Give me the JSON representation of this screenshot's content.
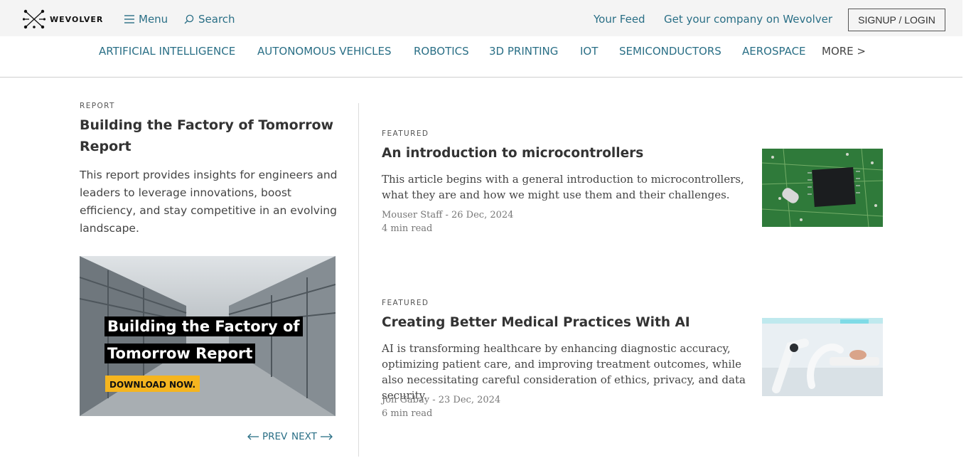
{
  "header": {
    "logo_text": "WEVOLVER",
    "menu_label": "Menu",
    "search_label": "Search",
    "your_feed": "Your Feed",
    "get_company": "Get your company on Wevolver",
    "signup_login": "SIGNUP / LOGIN"
  },
  "categories": [
    "ARTIFICIAL INTELLIGENCE",
    "AUTONOMOUS VEHICLES",
    "ROBOTICS",
    "3D PRINTING",
    "IOT",
    "SEMICONDUCTORS",
    "AEROSPACE",
    "MORE >"
  ],
  "report": {
    "eyebrow": "REPORT",
    "title": "Building the Factory of Tomorrow Report",
    "description": "This report provides insights for engineers and leaders to leverage innovations, boost efficiency, and stay competitive in an evolving landscape.",
    "banner_line1": "Building the Factory of",
    "banner_line2": "Tomorrow Report",
    "banner_cta": "DOWNLOAD NOW.",
    "prev_label": "PREV",
    "next_label": "NEXT"
  },
  "featured": [
    {
      "eyebrow": "FEATURED",
      "title": "An introduction to microcontrollers",
      "description": "This article begins with a general introduction to microcontrollers, what they are and how we might use them and their challenges.",
      "byline": "Mouser Staff - 26 Dec, 2024",
      "read_time": "4 min read",
      "image_icon": "microcontroller-chip-photo"
    },
    {
      "eyebrow": "FEATURED",
      "title": "Creating Better Medical Practices With AI",
      "description": "AI is transforming healthcare by enhancing diagnostic accuracy, optimizing patient care, and improving treatment outcomes, while also necessitating careful consideration of ethics, privacy, and data security.",
      "byline": "Jon Gabay - 23 Dec, 2024",
      "read_time": "6 min read",
      "image_icon": "medical-robot-photo"
    }
  ],
  "colors": {
    "link": "#2a6f86",
    "header_bg": "#f4f4f4",
    "cta_yellow": "#f5b51f"
  }
}
